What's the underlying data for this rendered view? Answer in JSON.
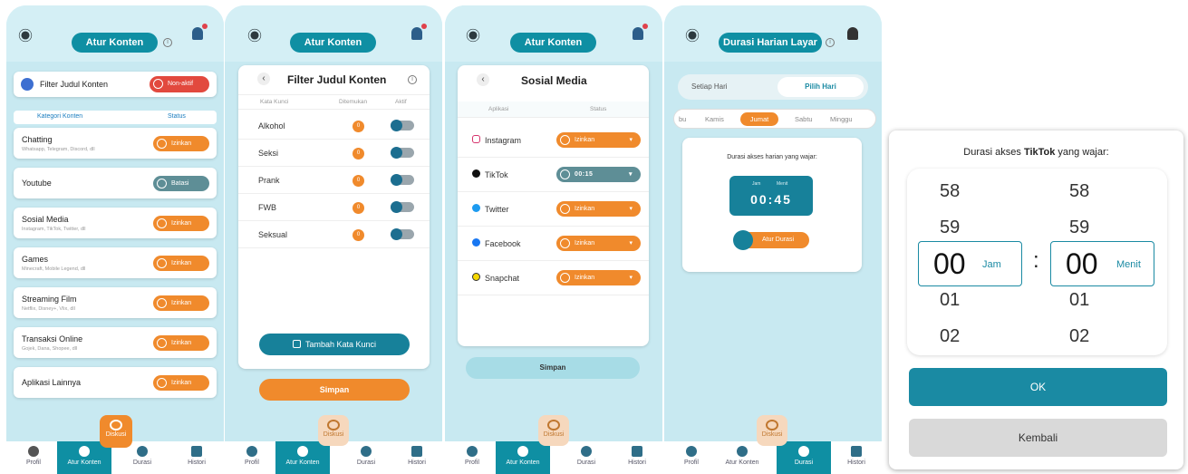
{
  "screen1": {
    "title": "Atur Konten",
    "filter": {
      "label": "Filter Judul Konten",
      "status": "Non-aktif"
    },
    "headers": {
      "category": "Kategori Konten",
      "status": "Status"
    },
    "rows": [
      {
        "name": "Chatting",
        "sub": "Whatsapp, Telegram, Discord, dll",
        "status": "Izinkan"
      },
      {
        "name": "Youtube",
        "sub": "",
        "status": "Batasi"
      },
      {
        "name": "Sosial Media",
        "sub": "Instagram, TikTok, Twitter, dll",
        "status": "Izinkan"
      },
      {
        "name": "Games",
        "sub": "Minecraft, Mobile Legend, dll",
        "status": "Izinkan"
      },
      {
        "name": "Streaming Film",
        "sub": "Netflix, Disney+, Vlix, dll",
        "status": "Izinkan"
      },
      {
        "name": "Transaksi Online",
        "sub": "Gojek, Dana, Shopee, dll",
        "status": "Izinkan"
      },
      {
        "name": "Aplikasi Lainnya",
        "sub": "",
        "status": "Izinkan"
      }
    ]
  },
  "screen2": {
    "title": "Atur Konten",
    "heading": "Filter Judul Konten",
    "cols": {
      "keyword": "Kata Kunci",
      "found": "Ditemukan",
      "active": "Aktif"
    },
    "keywords": [
      {
        "word": "Alkohol",
        "count": "0"
      },
      {
        "word": "Seksi",
        "count": "0"
      },
      {
        "word": "Prank",
        "count": "0"
      },
      {
        "word": "FWB",
        "count": "0"
      },
      {
        "word": "Seksual",
        "count": "0"
      }
    ],
    "add_label": "Tambah Kata Kunci",
    "save_label": "Simpan"
  },
  "screen3": {
    "title": "Atur Konten",
    "heading": "Sosial Media",
    "cols": {
      "app": "Aplikasi",
      "status": "Status"
    },
    "apps": [
      {
        "name": "Instagram",
        "status": "Izinkan"
      },
      {
        "name": "TikTok",
        "status": "00:15"
      },
      {
        "name": "Twitter",
        "status": "Izinkan"
      },
      {
        "name": "Facebook",
        "status": "Izinkan"
      },
      {
        "name": "Snapchat",
        "status": "Izinkan"
      }
    ],
    "save_label": "Simpan"
  },
  "screen4": {
    "title": "Durasi Harian Layar",
    "seg": {
      "every": "Setiap Hari",
      "pick": "Pilih Hari"
    },
    "days": [
      "bu",
      "Kamis",
      "Jumat",
      "Sabtu",
      "Minggu"
    ],
    "card_label": "Durasi akses harian yang wajar:",
    "time_labels": {
      "h": "Jam",
      "m": "Menit"
    },
    "time": "00:45",
    "edit_label": "Atur Durasi"
  },
  "nav": {
    "profil": "Profil",
    "atur": "Atur Konten",
    "durasi": "Durasi",
    "histori": "Histori",
    "diskusi": "Diskusi"
  },
  "dialog": {
    "title_prefix": "Durasi akses ",
    "title_bold": "TikTok",
    "title_suffix": " yang wajar:",
    "hours": [
      "58",
      "59",
      "00",
      "01",
      "02"
    ],
    "minutes": [
      "58",
      "59",
      "00",
      "01",
      "02"
    ],
    "unit_h": "Jam",
    "unit_m": "Menit",
    "sep": ":",
    "ok": "OK",
    "back": "Kembali"
  },
  "colors": {
    "teal": "#0f8fa3",
    "orange": "#f08a2c",
    "red": "#e2493e",
    "bg": "#c8e9f1"
  }
}
